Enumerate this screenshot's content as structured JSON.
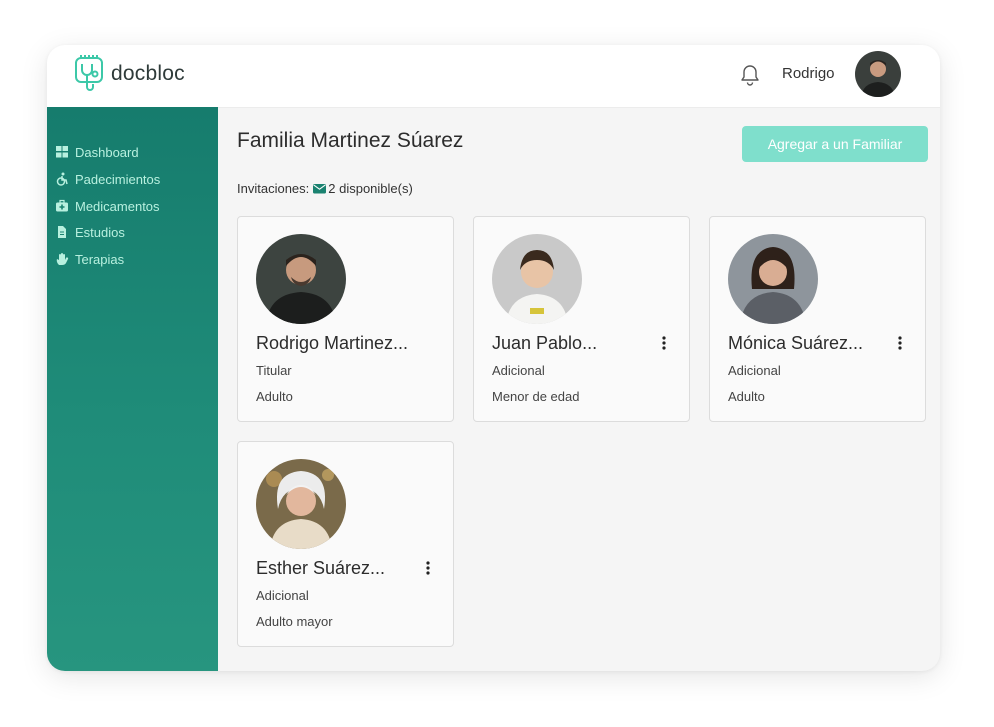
{
  "app": {
    "brand": "docbloc",
    "username": "Rodrigo"
  },
  "sidebar": {
    "items": [
      {
        "label": "Dashboard",
        "icon": "dashboard-grid-icon"
      },
      {
        "label": "Padecimientos",
        "icon": "accessibility-icon"
      },
      {
        "label": "Medicamentos",
        "icon": "medkit-icon"
      },
      {
        "label": "Estudios",
        "icon": "document-icon"
      },
      {
        "label": "Terapias",
        "icon": "hand-icon"
      }
    ]
  },
  "main": {
    "title": "Familia Martinez Súarez",
    "add_button": "Agregar a un Familiar",
    "invites_label": "Invitaciones:",
    "invites_count": "2 disponible(s)"
  },
  "members": [
    {
      "name": "Rodrigo Martinez...",
      "role": "Titular",
      "age_group": "Adulto"
    },
    {
      "name": "Juan Pablo...",
      "role": "Adicional",
      "age_group": "Menor de edad"
    },
    {
      "name": "Mónica Suárez...",
      "role": "Adicional",
      "age_group": "Adulto"
    },
    {
      "name": "Esther Suárez...",
      "role": "Adicional",
      "age_group": "Adulto mayor"
    }
  ],
  "colors": {
    "accent": "#7fdfcc",
    "sidebar": "#1a8270",
    "sidebar_text": "#b8f0df",
    "brand_icon": "#3cc8a8"
  }
}
